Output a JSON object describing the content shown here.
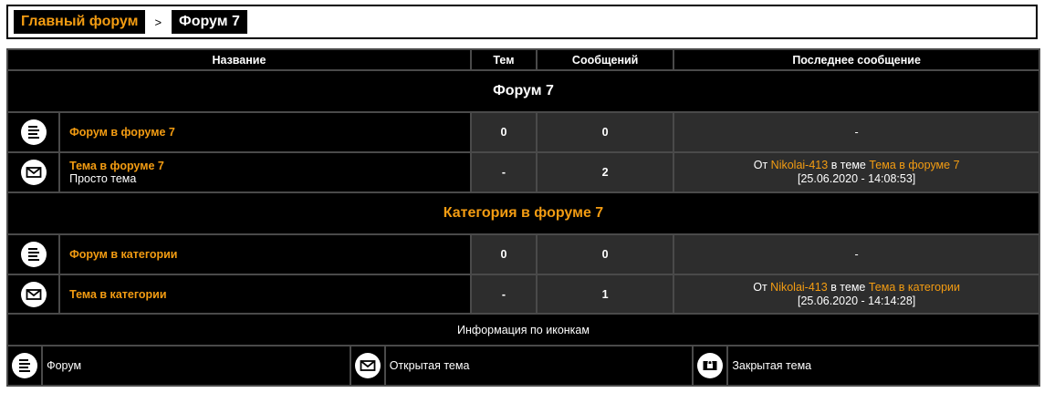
{
  "breadcrumb": {
    "home_label": "Главный форум",
    "separator": ">",
    "current_label": "Форум 7"
  },
  "table": {
    "headers": {
      "name": "Название",
      "topics": "Тем",
      "messages": "Сообщений",
      "last_message": "Последнее сообщение"
    },
    "sections": [
      {
        "title": "Форум 7",
        "rows": [
          {
            "icon": "forum-icon",
            "name": "Форум в форуме 7",
            "subtitle": "",
            "topics": "0",
            "messages": "0",
            "last_empty": "-"
          },
          {
            "icon": "open-topic-icon",
            "name": "Тема в форуме 7",
            "subtitle": "Просто тема",
            "topics": "-",
            "messages": "2",
            "last_from": "От",
            "last_author": "Nikolai-413",
            "last_in": "в теме",
            "last_topic": "Тема в форуме 7",
            "last_date": "[25.06.2020 - 14:08:53]"
          }
        ]
      },
      {
        "title": "Категория в форуме 7",
        "rows": [
          {
            "icon": "forum-icon",
            "name": "Форум в категории",
            "subtitle": "",
            "topics": "0",
            "messages": "0",
            "last_empty": "-"
          },
          {
            "icon": "open-topic-icon",
            "name": "Тема в категории",
            "subtitle": "",
            "topics": "-",
            "messages": "1",
            "last_from": "От",
            "last_author": "Nikolai-413",
            "last_in": "в теме",
            "last_topic": "Тема в категории",
            "last_date": "[25.06.2020 - 14:14:28]"
          }
        ]
      }
    ]
  },
  "legend": {
    "title": "Информация по иконкам",
    "items": [
      {
        "icon": "forum-icon",
        "label": "Форум"
      },
      {
        "icon": "open-topic-icon",
        "label": "Открытая тема"
      },
      {
        "icon": "closed-topic-icon",
        "label": "Закрытая тема"
      }
    ]
  },
  "colors": {
    "accent": "#f39c12",
    "background": "#000000",
    "cell_dark": "#2d2d2d",
    "border": "#4a4a4a"
  }
}
